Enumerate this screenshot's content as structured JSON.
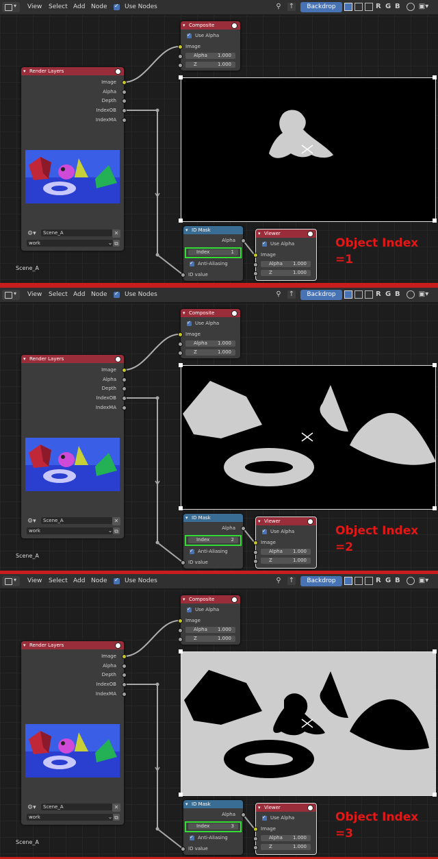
{
  "menu": {
    "view": "View",
    "select": "Select",
    "add": "Add",
    "node": "Node",
    "use_nodes": "Use Nodes"
  },
  "header_right": {
    "backdrop": "Backdrop",
    "r": "R",
    "g": "G",
    "b": "B"
  },
  "composite_node": {
    "title": "Composite",
    "use_alpha": "Use Alpha",
    "image": "Image",
    "alpha_label": "Alpha",
    "alpha_value": "1.000",
    "z_label": "Z",
    "z_value": "1.000"
  },
  "render_layers_node": {
    "title": "Render Layers",
    "outputs": [
      "Image",
      "Alpha",
      "Depth",
      "IndexOB",
      "IndexMA"
    ],
    "scene": "Scene_A",
    "layer": "work"
  },
  "id_mask_node": {
    "title": "ID Mask",
    "alpha": "Alpha",
    "index_label": "Index",
    "anti_aliasing": "Anti-Aliasing",
    "id_value": "ID value"
  },
  "viewer_node": {
    "title": "Viewer",
    "use_alpha": "Use Alpha",
    "image": "Image",
    "alpha_label": "Alpha",
    "alpha_value": "1.000",
    "z_label": "Z",
    "z_value": "1.000"
  },
  "scene_label": "Scene_A",
  "panels": [
    {
      "index_value": "1",
      "annotation_line1": "Object Index",
      "annotation_line2": "=1"
    },
    {
      "index_value": "2",
      "annotation_line1": "Object Index",
      "annotation_line2": "=2"
    },
    {
      "index_value": "3",
      "annotation_line1": "Object Index",
      "annotation_line2": "=3"
    }
  ],
  "colors": {
    "accent_blue": "#4772b3",
    "node_header_red": "#9a2d3a",
    "node_header_blue": "#3a6d94",
    "highlight_green": "#33dd33",
    "annotation_red": "#e01818",
    "separator_red": "#c81d1d"
  },
  "icons": [
    "editor-type-icon",
    "pin-icon",
    "parent-icon",
    "channel-icons",
    "zoom-icon",
    "render-globe-icon",
    "checkbox-icon",
    "close-icon",
    "browse-icon"
  ]
}
